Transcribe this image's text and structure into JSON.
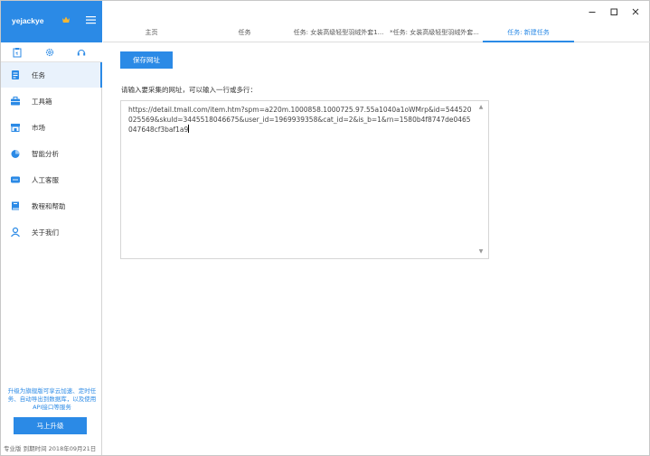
{
  "user": {
    "name": "yejackye"
  },
  "sidebar": {
    "items": [
      {
        "label": "任务"
      },
      {
        "label": "工具箱"
      },
      {
        "label": "市场"
      },
      {
        "label": "智能分析"
      },
      {
        "label": "人工客服"
      },
      {
        "label": "教程和帮助"
      },
      {
        "label": "关于我们"
      }
    ],
    "promo": "升级为旗舰版可享云加速、定时任务、自动导出到数据库，以及使用API接口等服务",
    "upgrade_label": "马上升级",
    "edition": "专业版",
    "expire_label": "到期时间",
    "expire_date": "2018年09月21日"
  },
  "tabs": [
    {
      "label": "主页"
    },
    {
      "label": "任务"
    },
    {
      "label": "任务: 女装高级轻型羽绒外套1..."
    },
    {
      "label": "*任务: 女装高级轻型羽绒外套..."
    },
    {
      "label": "任务: 新建任务"
    }
  ],
  "main": {
    "save_label": "保存网址",
    "prompt": "请输入要采集的网址，可以输入一行或多行：",
    "url_value": "https://detail.tmall.com/item.htm?spm=a220m.1000858.1000725.97.55a1040a1oWMrp&id=544520025569&skuId=3445518046675&user_id=1969939358&cat_id=2&is_b=1&rn=1580b4f8747de0465047648cf3baf1a9"
  },
  "colors": {
    "accent": "#2b8ae6",
    "active_bg": "#e9f2fc"
  }
}
